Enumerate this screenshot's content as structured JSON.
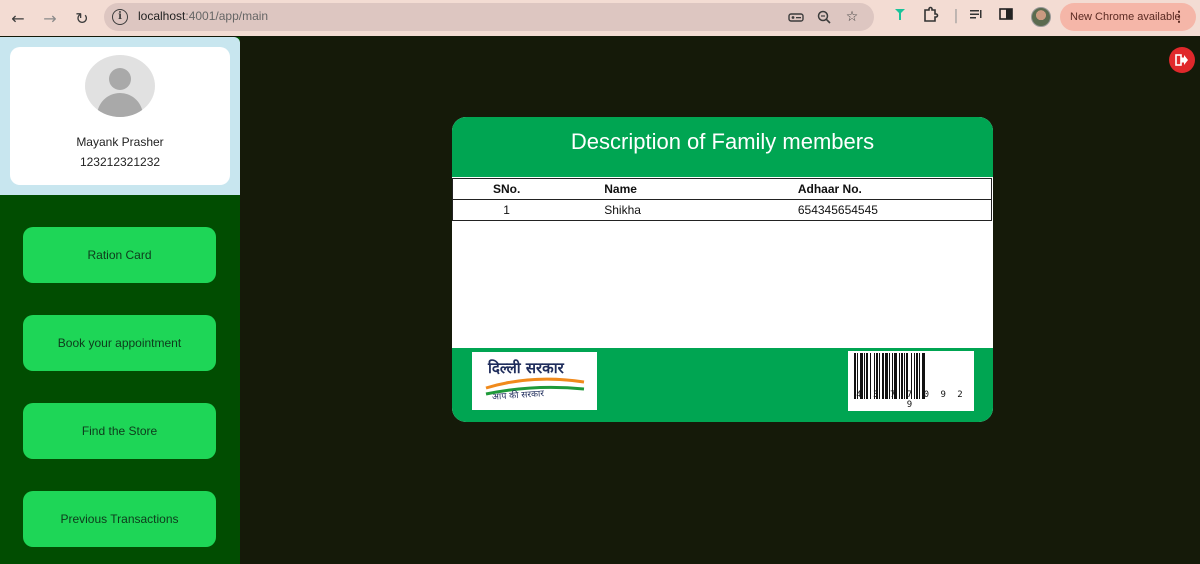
{
  "browser": {
    "url_host": "localhost",
    "url_path": ":4001/app/main",
    "update_label": "New Chrome available"
  },
  "profile": {
    "name": "Mayank Prasher",
    "id": "123212321232"
  },
  "sidebar": {
    "items": [
      {
        "label": "Ration Card"
      },
      {
        "label": "Book your appointment"
      },
      {
        "label": "Find the Store"
      },
      {
        "label": "Previous Transactions"
      }
    ]
  },
  "card": {
    "title": "Description of Family members",
    "columns": {
      "sno": "SNo.",
      "name": "Name",
      "adhaar": "Adhaar No."
    },
    "rows": [
      {
        "sno": "1",
        "name": "Shikha",
        "adhaar": "654345654545"
      }
    ],
    "logo": {
      "main": "दिल्ली सरकार",
      "sub": "आप की सरकार"
    },
    "barcode_digits": "4 3 7 7 0 9 2 9"
  },
  "colors": {
    "page_bg": "#151a09",
    "sidebar_bg": "#014d01",
    "button_green": "#1ed657",
    "card_green": "#00a552",
    "logout_red": "#e0282b"
  }
}
